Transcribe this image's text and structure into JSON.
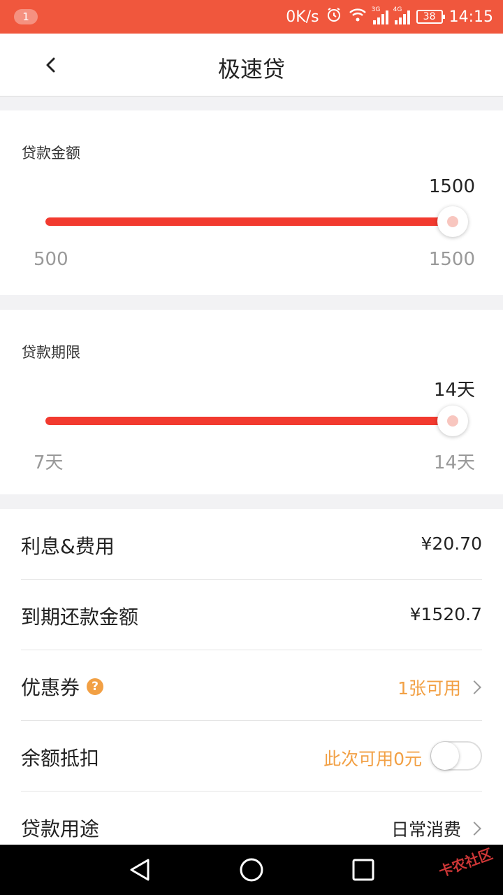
{
  "status_bar": {
    "notification_count": "1",
    "network_speed": "0K/s",
    "signal_1": "3G",
    "signal_2": "4G",
    "battery": "38",
    "time": "14:15"
  },
  "header": {
    "title": "极速贷"
  },
  "loan_amount": {
    "label": "贷款金额",
    "value": "1500",
    "min_label": "500",
    "max_label": "1500",
    "min": 500,
    "max": 1500,
    "current": 1500
  },
  "loan_term": {
    "label": "贷款期限",
    "value": "14天",
    "min_label": "7天",
    "max_label": "14天",
    "min": 7,
    "max": 14,
    "current": 14
  },
  "details": {
    "interest_label": "利息&费用",
    "interest_value": "¥20.70",
    "due_label": "到期还款金额",
    "due_value": "¥1520.7",
    "coupon_label": "优惠券",
    "coupon_value": "1张可用",
    "balance_label": "余额抵扣",
    "balance_value": "此次可用0元",
    "balance_toggle_on": false,
    "purpose_label": "贷款用途",
    "purpose_value": "日常消费"
  },
  "watermark": "卡农社区",
  "colors": {
    "status_bar": "#f0573d",
    "accent": "#f23a2f",
    "orange": "#f2a044"
  }
}
